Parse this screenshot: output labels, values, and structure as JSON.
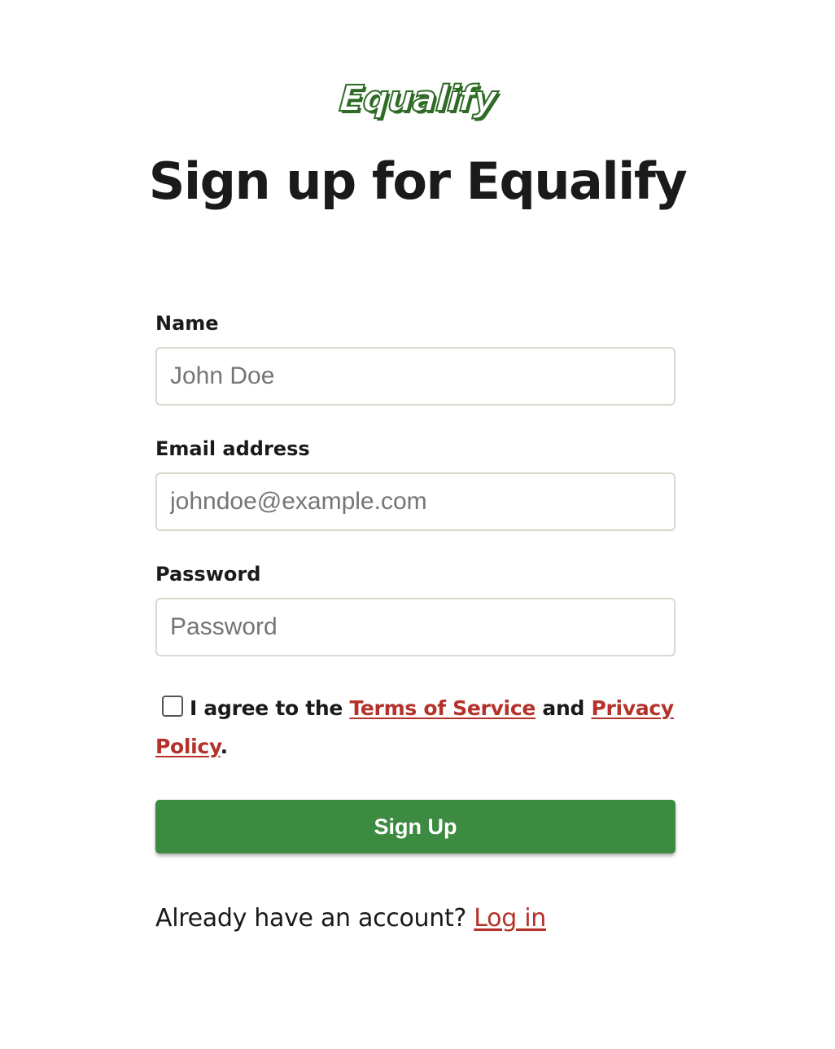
{
  "brand": {
    "logo_text": "Equalify",
    "logo_color": "#2e6b25"
  },
  "page": {
    "title": "Sign up for Equalify"
  },
  "form": {
    "name": {
      "label": "Name",
      "value": "",
      "placeholder": "John Doe"
    },
    "email": {
      "label": "Email address",
      "value": "",
      "placeholder": "johndoe@example.com"
    },
    "password": {
      "label": "Password",
      "value": "",
      "placeholder": "Password"
    },
    "agree": {
      "checked": false,
      "text_before": "I agree to the",
      "terms_link": "Terms of Service",
      "text_middle": "and",
      "privacy_link": "Privacy Policy",
      "text_after": "."
    },
    "submit_label": "Sign Up"
  },
  "footer": {
    "prompt": "Already have an account?",
    "login_link": "Log in"
  },
  "colors": {
    "button": "#3d8a41",
    "link": "#b4322a",
    "text": "#1a1a1a"
  }
}
